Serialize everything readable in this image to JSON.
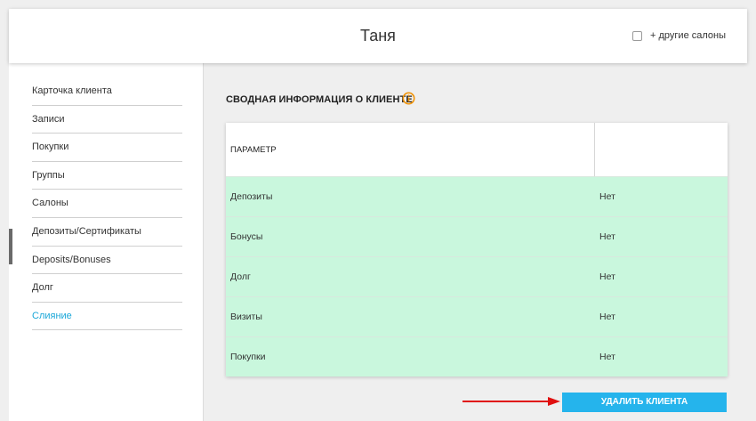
{
  "header": {
    "title": "Таня",
    "other_salons_label": "+ другие салоны"
  },
  "sidebar": {
    "items": [
      {
        "label": "Карточка клиента"
      },
      {
        "label": "Записи"
      },
      {
        "label": "Покупки"
      },
      {
        "label": "Группы"
      },
      {
        "label": "Салоны"
      },
      {
        "label": "Депозиты/Сертификаты"
      },
      {
        "label": "Deposits/Bonuses"
      },
      {
        "label": "Долг"
      },
      {
        "label": "Слияние"
      }
    ],
    "active_item": "Слияние"
  },
  "main": {
    "section_title": "СВОДНАЯ ИНФОРМАЦИЯ О КЛИЕНТЕ",
    "table": {
      "header": {
        "param": "ПАРАМЕТР",
        "value": ""
      },
      "rows": [
        {
          "name": "Депозиты",
          "value": "Нет"
        },
        {
          "name": "Бонусы",
          "value": "Нет"
        },
        {
          "name": "Долг",
          "value": "Нет"
        },
        {
          "name": "Визиты",
          "value": "Нет"
        },
        {
          "name": "Покупки",
          "value": "Нет"
        }
      ]
    },
    "delete_button_label": "УДАЛИТЬ КЛИЕНТА"
  },
  "colors": {
    "accent": "#25b4ec",
    "active_nav": "#1aa7d8",
    "row_bg": "#c9f7dd",
    "info_icon": "#f0940a",
    "arrow": "#e01010"
  },
  "icons": {
    "info": "info-icon",
    "arrow": "arrow-right-icon"
  }
}
